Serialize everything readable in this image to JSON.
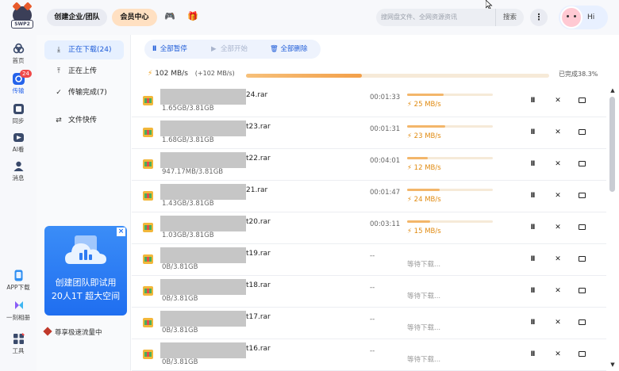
{
  "header": {
    "logo_text": "SWP2",
    "create_team_label": "创建企业/团队",
    "vip_center_label": "会员中心",
    "search_placeholder": "搜网盘文件、全网资源资讯",
    "search_button": "搜索",
    "more_label": "⋮",
    "user_greeting": "Hi"
  },
  "nav": {
    "items": [
      {
        "label": "首页",
        "icon": "home-icon",
        "color": "#3a4a6b"
      },
      {
        "label": "传输",
        "icon": "transfer-icon",
        "color": "#2563eb",
        "badge": "24"
      },
      {
        "label": "同步",
        "icon": "sync-icon",
        "color": "#3a4a6b"
      },
      {
        "label": "AI看",
        "icon": "ai-icon",
        "color": "#3a4a6b"
      },
      {
        "label": "消息",
        "icon": "message-icon",
        "color": "#3a4a6b"
      },
      {
        "label": "APP下载",
        "icon": "phone-icon",
        "color": "#2f8ff2"
      },
      {
        "label": "一刻相册",
        "icon": "album-icon",
        "color": "#8a5cf6"
      },
      {
        "label": "工具",
        "icon": "tools-icon",
        "color": "#3a4a6b"
      }
    ]
  },
  "subside": {
    "items": [
      {
        "label": "正在下载(24)",
        "icon": "download-icon",
        "active": true
      },
      {
        "label": "正在上传",
        "icon": "upload-icon",
        "active": false
      },
      {
        "label": "传输完成(7)",
        "icon": "check-circle-icon",
        "active": false
      },
      {
        "label": "文件快传",
        "icon": "quick-transfer-icon",
        "active": false
      }
    ],
    "promo": {
      "line1": "创建团队即试用",
      "line2": "20人1T 超大空间",
      "close": "×"
    },
    "speed_link": "尊享极速流量中"
  },
  "toolbar": {
    "pause_all": "全部暂停",
    "start_all": "全部开始",
    "delete_all": "全部删除"
  },
  "summary": {
    "speed": "102 MB/s",
    "total": "(+102 MB/s)",
    "progress": 0.383,
    "done_text": "已完成38.3%"
  },
  "files": [
    {
      "name": "24.rar",
      "size": "1.65GB/3.81GB",
      "time": "00:01:33",
      "progress": 0.43,
      "speed": "25 MB/s",
      "waiting": false
    },
    {
      "name": "t23.rar",
      "size": "1.68GB/3.81GB",
      "time": "00:01:31",
      "progress": 0.44,
      "speed": "23 MB/s",
      "waiting": false
    },
    {
      "name": "t22.rar",
      "size": "947.17MB/3.81GB",
      "time": "00:04:01",
      "progress": 0.24,
      "speed": "12 MB/s",
      "waiting": false
    },
    {
      "name": "21.rar",
      "size": "1.43GB/3.81GB",
      "time": "00:01:47",
      "progress": 0.38,
      "speed": "24 MB/s",
      "waiting": false
    },
    {
      "name": "t20.rar",
      "size": "1.03GB/3.81GB",
      "time": "00:03:11",
      "progress": 0.27,
      "speed": "15 MB/s",
      "waiting": false
    },
    {
      "name": "t19.rar",
      "size": "0B/3.81GB",
      "time": "--",
      "progress": 0,
      "speed": "等待下载...",
      "waiting": true
    },
    {
      "name": "t18.rar",
      "size": "0B/3.81GB",
      "time": "--",
      "progress": 0,
      "speed": "等待下载...",
      "waiting": true
    },
    {
      "name": "t17.rar",
      "size": "0B/3.81GB",
      "time": "--",
      "progress": 0,
      "speed": "等待下载...",
      "waiting": true
    },
    {
      "name": "t16.rar",
      "size": "0B/3.81GB",
      "time": "--",
      "progress": 0,
      "speed": "等待下载...",
      "waiting": true
    }
  ],
  "row_actions": {
    "pause": "II",
    "cancel": "✕"
  },
  "colors": {
    "accent": "#2563eb",
    "speed": "#e08a10",
    "progress": "#f3b66a"
  }
}
